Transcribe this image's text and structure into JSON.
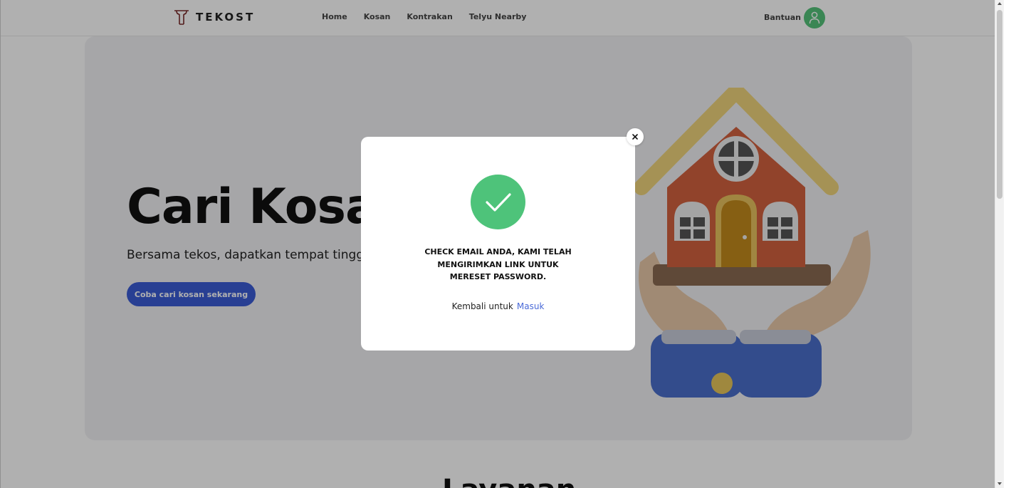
{
  "brand": {
    "name": "TEKOST",
    "logo_icon": "tekost-t-logo-icon"
  },
  "nav": {
    "links": [
      "Home",
      "Kosan",
      "Kontrakan",
      "Telyu Nearby"
    ],
    "help": "Bantuan",
    "avatar_icon": "user-icon"
  },
  "hero": {
    "title": "Cari Kosan",
    "subtitle": "Bersama tekos, dapatkan tempat tinggal",
    "cta": "Coba cari kosan sekarang",
    "illustration": "house-in-hands-illustration"
  },
  "section": {
    "title": "Layanan"
  },
  "modal": {
    "status_icon": "check-icon",
    "message_lines": [
      "CHECK EMAIL ANDA, KAMI TELAH",
      "MENGIRIMKAN LINK UNTUK",
      "MERESET PASSWORD."
    ],
    "back_text": "Kembali untuk",
    "login_link": "Masuk",
    "close_icon": "close-icon"
  },
  "colors": {
    "accent_blue": "#3b5cd6",
    "success_green": "#4ec37a",
    "link_blue": "#4a6ad8"
  }
}
